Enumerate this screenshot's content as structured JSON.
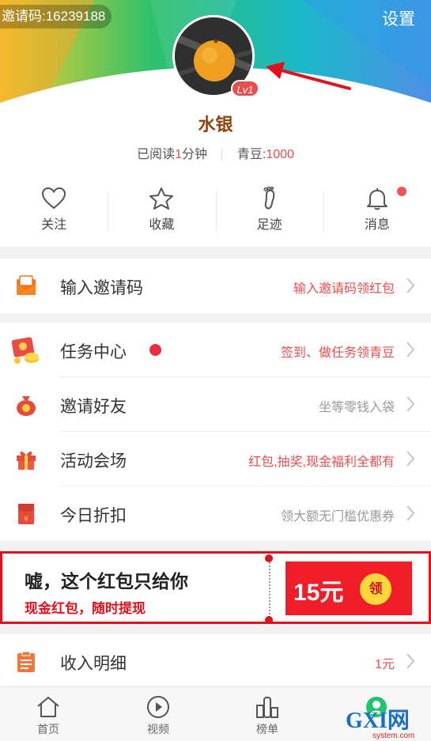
{
  "header": {
    "invite_code": "邀请码:16239188",
    "settings": "设置",
    "level": "Lv1",
    "username": "水银",
    "read_prefix": "已阅读",
    "read_value": "1",
    "read_suffix": "分钟",
    "beans_label": "青豆:",
    "beans_value": "1000"
  },
  "quick_actions": [
    {
      "label": "关注",
      "icon": "heart-icon"
    },
    {
      "label": "收藏",
      "icon": "star-icon"
    },
    {
      "label": "足迹",
      "icon": "footprint-icon"
    },
    {
      "label": "消息",
      "icon": "bell-icon",
      "badge": true
    }
  ],
  "menu": [
    {
      "title": "输入邀请码",
      "desc": "输入邀请码领红包",
      "icon": "envelope-888-icon"
    },
    {
      "title": "任务中心",
      "desc": "签到、做任务领青豆",
      "icon": "red-packet-coins-icon",
      "badge": true
    },
    {
      "title": "邀请好友",
      "desc": "坐等零钱入袋",
      "icon": "money-bag-icon"
    },
    {
      "title": "活动会场",
      "desc": "红包,抽奖,现金福利全都有",
      "icon": "gift-icon"
    },
    {
      "title": "今日折扣",
      "desc": "领大额无门槛优惠券",
      "icon": "red-envelope-yuan-icon"
    },
    {
      "title": "收入明细",
      "desc": "1元",
      "icon": "clipboard-icon"
    }
  ],
  "banner": {
    "title": "嘘，这个红包只给你",
    "subtitle": "现金红包，随时提现",
    "amount": "15元",
    "claim": "领"
  },
  "tabs": [
    {
      "label": "首页",
      "icon": "home-icon"
    },
    {
      "label": "视频",
      "icon": "play-icon"
    },
    {
      "label": "榜单",
      "icon": "ranking-icon"
    },
    {
      "label": "",
      "icon": "profile-icon"
    }
  ],
  "watermark": {
    "logo": "GXI网",
    "site": "system.com"
  },
  "colors": {
    "accent_red": "#e84e4e",
    "banner_red": "#e0101c",
    "username_brown": "#8b4513",
    "desc_red": "#e84e4e",
    "desc_gray": "#999999"
  }
}
